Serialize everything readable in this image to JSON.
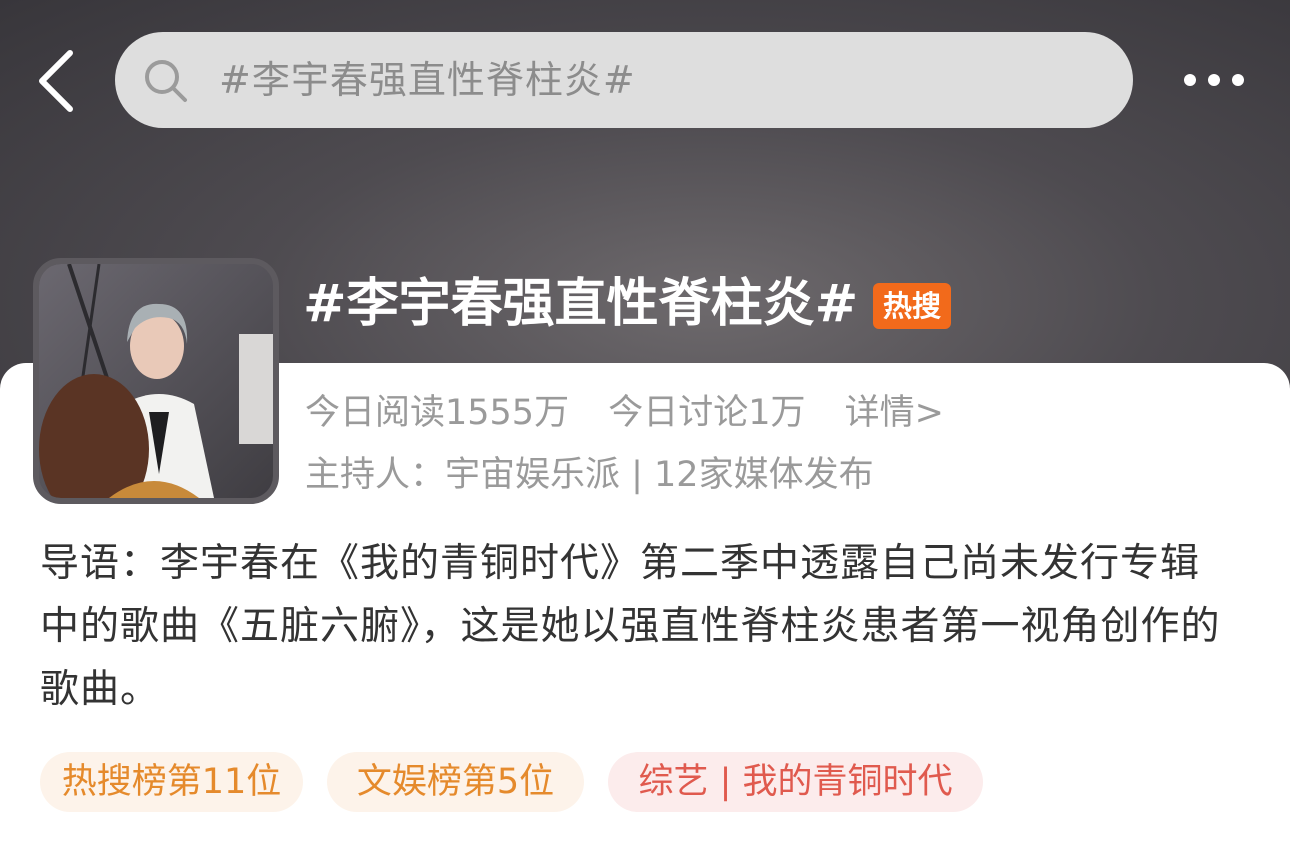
{
  "search": {
    "query": "#李宇春强直性脊柱炎#"
  },
  "topic": {
    "title": "#李宇春强直性脊柱炎#",
    "badge": "热搜",
    "reads": "今日阅读1555万",
    "discussions": "今日讨论1万",
    "detail_link": "详情>",
    "host": "主持人：宇宙娱乐派 | 12家媒体发布"
  },
  "intro": "导语：李宇春在《我的青铜时代》第二季中透露自己尚未发行专辑中的歌曲《五脏六腑》，这是她以强直性脊柱炎患者第一视角创作的歌曲。",
  "tags": [
    "热搜榜第11位",
    "文娱榜第5位",
    "综艺 | 我的青铜时代"
  ],
  "colors": {
    "badge_bg": "#f26a1b",
    "tag_orange_text": "#e58a2c",
    "tag_orange_bg": "#fdf3ea",
    "tag_red_text": "#e05a4e",
    "tag_red_bg": "#fcecec"
  }
}
